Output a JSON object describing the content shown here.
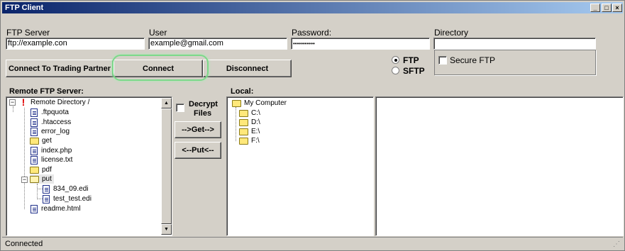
{
  "window": {
    "title": "FTP Client",
    "min_icon": "_",
    "max_icon": "□",
    "close_icon": "×"
  },
  "connection": {
    "server_label": "FTP Server",
    "server_value": "ftp://example.con",
    "user_label": "User",
    "user_value": "example@gmail.com",
    "password_label": "Password:",
    "password_value": "•••••••••••",
    "directory_label": "Directory",
    "directory_value": ""
  },
  "buttons": {
    "trading_partner": "Connect To Trading Partner",
    "connect": "Connect",
    "disconnect": "Disconnect",
    "get": "-->Get-->",
    "put": "<--Put<--"
  },
  "protocol": {
    "ftp_label": "FTP",
    "sftp_label": "SFTP",
    "selected": "FTP",
    "secure_label": "Secure FTP",
    "secure_checked": false
  },
  "decrypt": {
    "label_line1": "Decrypt",
    "label_line2": "Files",
    "checked": false
  },
  "remote": {
    "heading": "Remote FTP Server:",
    "root_label": "Remote Directory /",
    "items": [
      {
        "label": ".ftpquota",
        "type": "file"
      },
      {
        "label": ".htaccess",
        "type": "file"
      },
      {
        "label": "error_log",
        "type": "file"
      },
      {
        "label": "get",
        "type": "folder"
      },
      {
        "label": "index.php",
        "type": "file"
      },
      {
        "label": "license.txt",
        "type": "file"
      },
      {
        "label": "pdf",
        "type": "folder"
      },
      {
        "label": "put",
        "type": "folder-open"
      },
      {
        "label": "834_09.edi",
        "type": "file"
      },
      {
        "label": "test_test.edi",
        "type": "file"
      },
      {
        "label": "readme.html",
        "type": "file"
      }
    ]
  },
  "local": {
    "heading": "Local:",
    "root_label": "My Computer",
    "drives": [
      "C:\\",
      "D:\\",
      "E:\\",
      "F:\\"
    ]
  },
  "status": {
    "text": "Connected",
    "grip": "⋰"
  },
  "colors": {
    "window_bg": "#d4d0c8",
    "title_start": "#0a246a",
    "title_end": "#a6caf0",
    "highlight_ring": "#7cd98a",
    "warning_icon": "#e00000"
  }
}
